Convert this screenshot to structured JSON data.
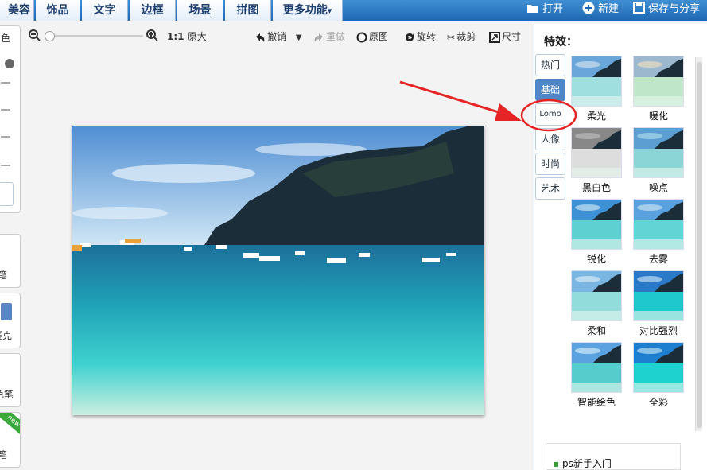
{
  "nav": {
    "tabs": [
      "美容",
      "饰品",
      "文字",
      "边框",
      "场景",
      "拼图",
      "更多功能"
    ],
    "more_arrow": "▾",
    "open": "打开",
    "new": "新建",
    "save_share": "保存与分享"
  },
  "left_tools": {
    "top_label": "色",
    "brush1": "笔",
    "brush2": "赛克",
    "brush3": "色笔",
    "brush4": "笔",
    "new_badge": "new"
  },
  "toolbar": {
    "zoom_ratio": "1:1",
    "original_size": "原大",
    "undo": "撤销",
    "redo": "重做",
    "original": "原图",
    "rotate": "旋转",
    "crop": "裁剪",
    "size": "尺寸",
    "zoom_level": 0.0
  },
  "effects": {
    "title": "特效：",
    "categories": [
      "热门",
      "基础",
      "Lomo",
      "人像",
      "时尚",
      "艺术"
    ],
    "active_category": "基础",
    "items": [
      "柔光",
      "暖化",
      "黑白色",
      "噪点",
      "锐化",
      "去雾",
      "柔和",
      "对比强烈",
      "智能绘色",
      "全彩"
    ]
  },
  "help": {
    "link": "ps新手入门"
  },
  "colors": {
    "nav_blue": "#1f67b3",
    "active_tab": "#4e86c8",
    "annotation_red": "#e52525"
  }
}
